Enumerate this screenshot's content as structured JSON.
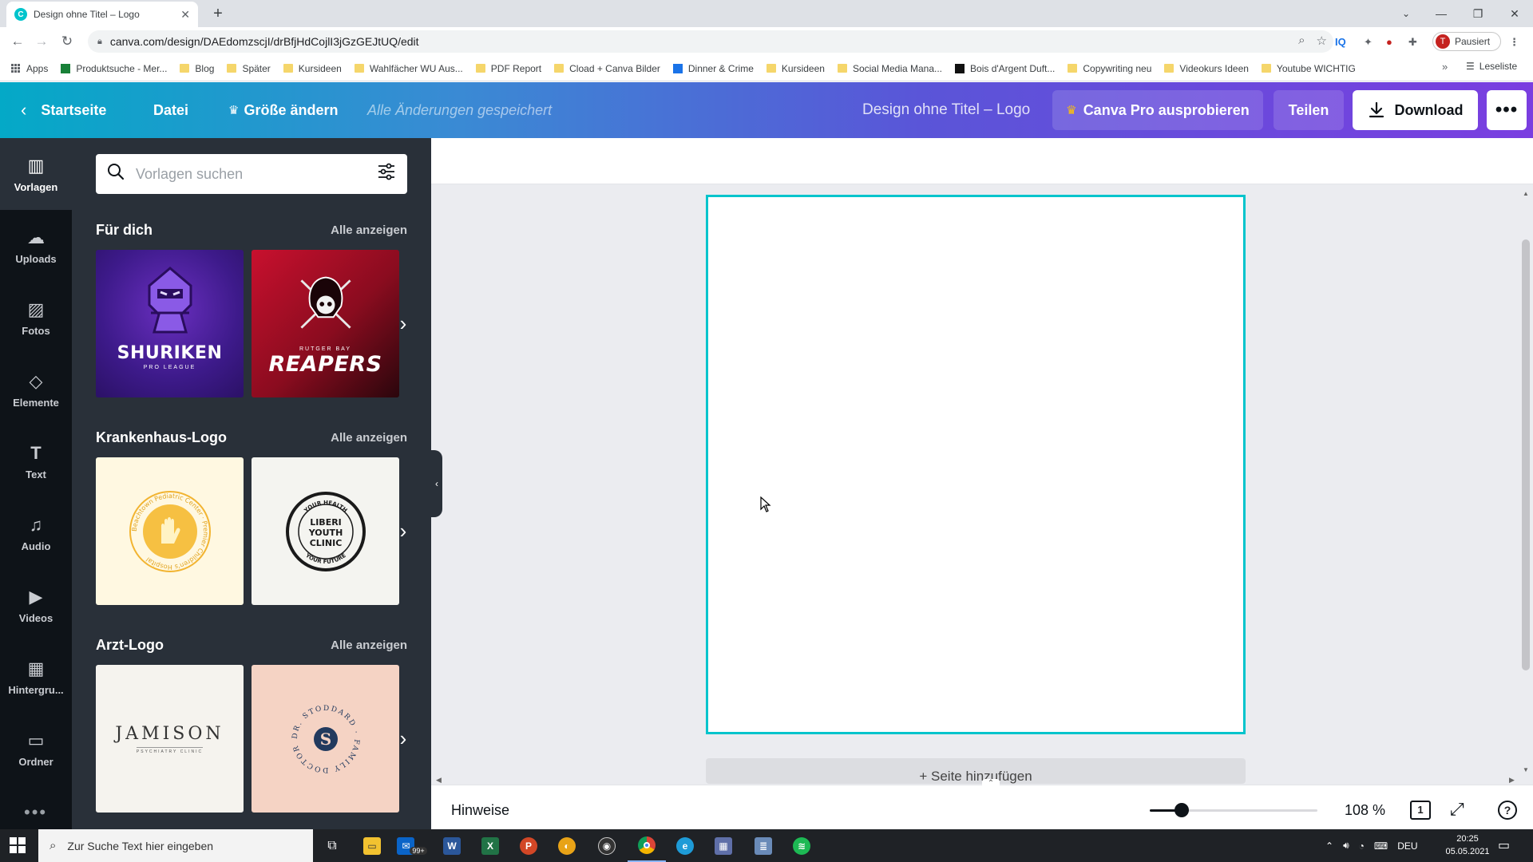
{
  "browser": {
    "tab_title": "Design ohne Titel – Logo",
    "tab_favicon": "C",
    "url": "canva.com/design/DAEdomzscjI/drBfjHdCojlI3jGzGEJtUQ/edit",
    "profile_initial": "T",
    "profile_status": "Pausiert",
    "ext_iq": "IQ",
    "bookmarks": [
      {
        "label": "Apps",
        "type": "apps"
      },
      {
        "label": "Produktsuche - Mer...",
        "type": "green"
      },
      {
        "label": "Blog",
        "type": "folder"
      },
      {
        "label": "Später",
        "type": "folder"
      },
      {
        "label": "Kursideen",
        "type": "folder"
      },
      {
        "label": "Wahlfächer WU Aus...",
        "type": "folder"
      },
      {
        "label": "PDF Report",
        "type": "folder"
      },
      {
        "label": "Cload + Canva Bilder",
        "type": "folder"
      },
      {
        "label": "Dinner & Crime",
        "type": "jd"
      },
      {
        "label": "Kursideen",
        "type": "folder"
      },
      {
        "label": "Social Media Mana...",
        "type": "folder"
      },
      {
        "label": "Bois d'Argent Duft...",
        "type": "dark"
      },
      {
        "label": "Copywriting neu",
        "type": "folder"
      },
      {
        "label": "Videokurs Ideen",
        "type": "folder"
      },
      {
        "label": "Youtube WICHTIG",
        "type": "folder"
      }
    ],
    "more_bookmarks": "»",
    "reading_list": "Leseliste"
  },
  "canva_bar": {
    "home": "Startseite",
    "file": "Datei",
    "resize": "Größe ändern",
    "saved_status": "Alle Änderungen gespeichert",
    "design_title": "Design ohne Titel – Logo",
    "pro": "Canva Pro ausprobieren",
    "share": "Teilen",
    "download": "Download"
  },
  "rail": [
    {
      "label": "Vorlagen",
      "icon": "templates-icon",
      "glyph": "▥"
    },
    {
      "label": "Uploads",
      "icon": "upload-icon",
      "glyph": "☁"
    },
    {
      "label": "Fotos",
      "icon": "photo-icon",
      "glyph": "▨"
    },
    {
      "label": "Elemente",
      "icon": "elements-icon",
      "glyph": "◇"
    },
    {
      "label": "Text",
      "icon": "text-icon",
      "glyph": "T"
    },
    {
      "label": "Audio",
      "icon": "music-icon",
      "glyph": "♫"
    },
    {
      "label": "Videos",
      "icon": "video-icon",
      "glyph": "▶"
    },
    {
      "label": "Hintergru...",
      "icon": "background-icon",
      "glyph": "▦"
    },
    {
      "label": "Ordner",
      "icon": "folder-icon",
      "glyph": "▭"
    }
  ],
  "panel": {
    "search_placeholder": "Vorlagen suchen",
    "sections": [
      {
        "title": "Für dich",
        "see_all": "Alle anzeigen"
      },
      {
        "title": "Krankenhaus-Logo",
        "see_all": "Alle anzeigen"
      },
      {
        "title": "Arzt-Logo",
        "see_all": "Alle anzeigen"
      }
    ],
    "thumbs": {
      "shuriken": {
        "big": "SHURIKEN",
        "small": "PRO LEAGUE"
      },
      "reapers": {
        "small": "RUTGER BAY",
        "big": "REAPERS"
      },
      "pediatric": {
        "ring": "Beachtown Pediatric Center · Premier Children's Hospital"
      },
      "liberi": {
        "top": "YOUR HEALTH",
        "l1": "LIBERI",
        "l2": "YOUTH",
        "l3": "CLINIC",
        "bottom": "YOUR FUTURE"
      },
      "jamison": {
        "big": "JAMISON",
        "small": "PSYCHIATRY CLINIC"
      },
      "stoddard": {
        "letter": "S",
        "ring": "DR. STODDARD · FAMILY DOCTOR"
      }
    }
  },
  "canvas": {
    "add_page": "+ Seite hinzufügen"
  },
  "footer": {
    "notes": "Hinweise",
    "zoom": "108 %",
    "page_count": "1",
    "zoom_level_fraction": 0.19
  },
  "taskbar": {
    "search_placeholder": "Zur Suche Text hier eingeben",
    "mail_badge": "99+",
    "language": "DEU",
    "time": "20:25",
    "date": "05.05.2021"
  }
}
